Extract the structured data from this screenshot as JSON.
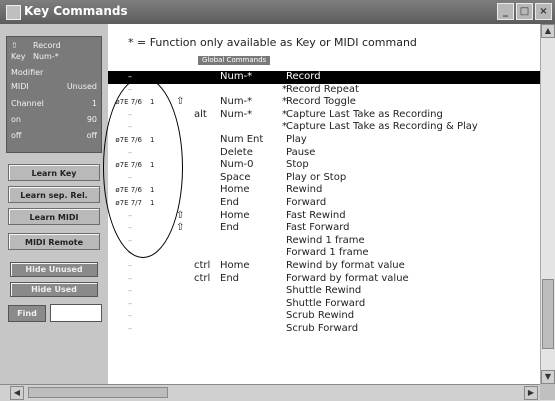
{
  "window": {
    "title": "Key Commands",
    "minimize": "_",
    "maximize": "□",
    "close": "×"
  },
  "status": {
    "rows": [
      {
        "k": "⇧",
        "v": "Record"
      },
      {
        "k": "Key",
        "v": "Num-*"
      },
      {
        "k": "Modifier",
        "v": ""
      },
      {
        "k": "MIDI",
        "v": "Unused"
      },
      {
        "k": "Channel",
        "v": "1"
      },
      {
        "k": "on",
        "v": "90"
      },
      {
        "k": "off",
        "v": "off"
      }
    ]
  },
  "sidebar": {
    "learn_key": "Learn Key",
    "learn_sep": "Learn sep. Rel.",
    "learn_midi": "Learn MIDI",
    "midi_remote": "MIDI Remote",
    "hide_unused": "Hide Unused",
    "hide_used": "Hide Used",
    "find": "Find"
  },
  "main": {
    "note": "* = Function only available as Key or MIDI command",
    "section": "Global Commands",
    "rows": [
      {
        "midi": "",
        "ch": "",
        "mod": "",
        "mod2": "",
        "key": "Num-*",
        "star": "",
        "func": "Record",
        "sel": true
      },
      {
        "midi": "",
        "ch": "",
        "mod": "",
        "mod2": "",
        "key": "",
        "star": "*",
        "func": "Record Repeat"
      },
      {
        "midi": "ø7E 7/6",
        "ch": "1",
        "mod": "⇧",
        "mod2": "",
        "key": "Num-*",
        "star": "*",
        "func": "Record Toggle"
      },
      {
        "midi": "",
        "ch": "",
        "mod": "",
        "mod2": "alt",
        "key": "Num-*",
        "star": "*",
        "func": "Capture Last Take as Recording"
      },
      {
        "midi": "",
        "ch": "",
        "mod": "",
        "mod2": "",
        "key": "",
        "star": "*",
        "func": "Capture Last Take as Recording & Play"
      },
      {
        "midi": "ø7E 7/6",
        "ch": "1",
        "mod": "",
        "mod2": "",
        "key": "Num Ent",
        "star": "",
        "func": "Play"
      },
      {
        "midi": "",
        "ch": "",
        "mod": "",
        "mod2": "",
        "key": "Delete",
        "star": "",
        "func": "Pause"
      },
      {
        "midi": "ø7E 7/6",
        "ch": "1",
        "mod": "",
        "mod2": "",
        "key": "Num-0",
        "star": "",
        "func": "Stop"
      },
      {
        "midi": "",
        "ch": "",
        "mod": "",
        "mod2": "",
        "key": "Space",
        "star": "",
        "func": "Play or Stop"
      },
      {
        "midi": "ø7E 7/6",
        "ch": "1",
        "mod": "",
        "mod2": "",
        "key": "Home",
        "star": "",
        "func": "Rewind"
      },
      {
        "midi": "ø7E 7/7",
        "ch": "1",
        "mod": "",
        "mod2": "",
        "key": "End",
        "star": "",
        "func": "Forward"
      },
      {
        "midi": "",
        "ch": "",
        "mod": "⇧",
        "mod2": "",
        "key": "Home",
        "star": "",
        "func": "Fast Rewind"
      },
      {
        "midi": "",
        "ch": "",
        "mod": "⇧",
        "mod2": "",
        "key": "End",
        "star": "",
        "func": "Fast Forward"
      },
      {
        "midi": "",
        "ch": "",
        "mod": "",
        "mod2": "",
        "key": "",
        "star": "",
        "func": "Rewind 1 frame"
      },
      {
        "midi": "",
        "ch": "",
        "mod": "",
        "mod2": "",
        "key": "",
        "star": "",
        "func": "Forward 1 frame"
      },
      {
        "midi": "",
        "ch": "",
        "mod": "",
        "mod2": "ctrl",
        "key": "Home",
        "star": "",
        "func": "Rewind by format value"
      },
      {
        "midi": "",
        "ch": "",
        "mod": "",
        "mod2": "ctrl",
        "key": "End",
        "star": "",
        "func": "Forward by format value"
      },
      {
        "midi": "",
        "ch": "",
        "mod": "",
        "mod2": "",
        "key": "",
        "star": "",
        "func": "Shuttle Rewind"
      },
      {
        "midi": "",
        "ch": "",
        "mod": "",
        "mod2": "",
        "key": "",
        "star": "",
        "func": "Shuttle Forward"
      },
      {
        "midi": "",
        "ch": "",
        "mod": "",
        "mod2": "",
        "key": "",
        "star": "",
        "func": "Scrub Rewind"
      },
      {
        "midi": "",
        "ch": "",
        "mod": "",
        "mod2": "",
        "key": "",
        "star": "",
        "func": "Scrub Forward"
      }
    ]
  },
  "scroll": {
    "up": "▲",
    "down": "▼",
    "left": "◀",
    "right": "▶"
  }
}
